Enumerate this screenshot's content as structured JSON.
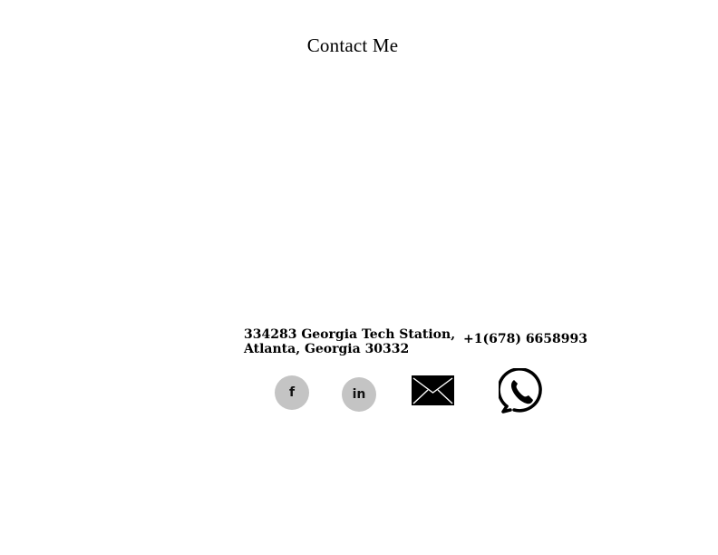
{
  "page": {
    "title": "Contact Me"
  },
  "contact": {
    "address_line1": "334283 Georgia Tech Station,",
    "address_line2": "Atlanta, Georgia 30332",
    "phone": "+1(678) 6658993"
  },
  "social": {
    "facebook_glyph": "f",
    "linkedin_glyph": "in",
    "facebook_icon": "facebook-icon",
    "linkedin_icon": "linkedin-icon",
    "email_icon": "envelope-icon",
    "phone_icon": "phone-icon",
    "circle_color": "#c4c4c4"
  }
}
